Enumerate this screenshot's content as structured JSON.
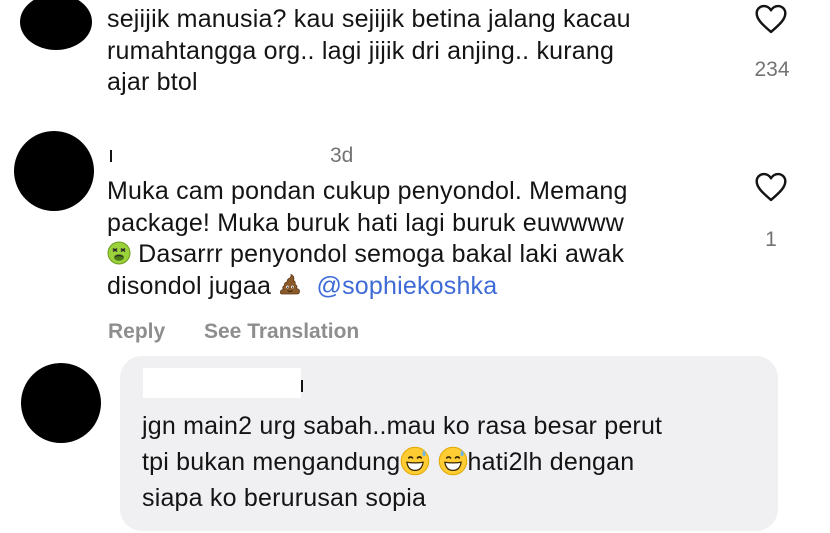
{
  "comment1": {
    "lines": [
      "sejijik manusia? kau sejijik betina jalang kacau",
      "rumahtangga org.. lagi jijik dri anjing.. kurang",
      "ajar btol"
    ],
    "likes": "234"
  },
  "comment2": {
    "time": "3d",
    "line1": "Muka cam pondan cukup penyondol. Memang",
    "line2": "package! Muka buruk hati lagi buruk euwwww",
    "line3": " Dasarrr penyondol semoga bakal laki awak",
    "line4": "disondol jugaa ",
    "mention": "@sophiekoshka",
    "likes": "1",
    "reply_label": "Reply",
    "translate_label": "See Translation",
    "emoji1": "nauseated-face",
    "emoji2": "pile-of-poo"
  },
  "comment3": {
    "line1": "jgn main2 urg sabah..mau ko rasa besar perut",
    "line2a": "tpi bukan mengandung",
    "line2b": "hati2lh dengan",
    "line3": "siapa ko berurusan sopia",
    "emoji": "grinning-face-with-sweat"
  },
  "colors": {
    "text": "#141414",
    "muted": "#737373",
    "mention": "#3e6bd6",
    "bubble": "#f0f0f2",
    "avatar": "#000000"
  }
}
